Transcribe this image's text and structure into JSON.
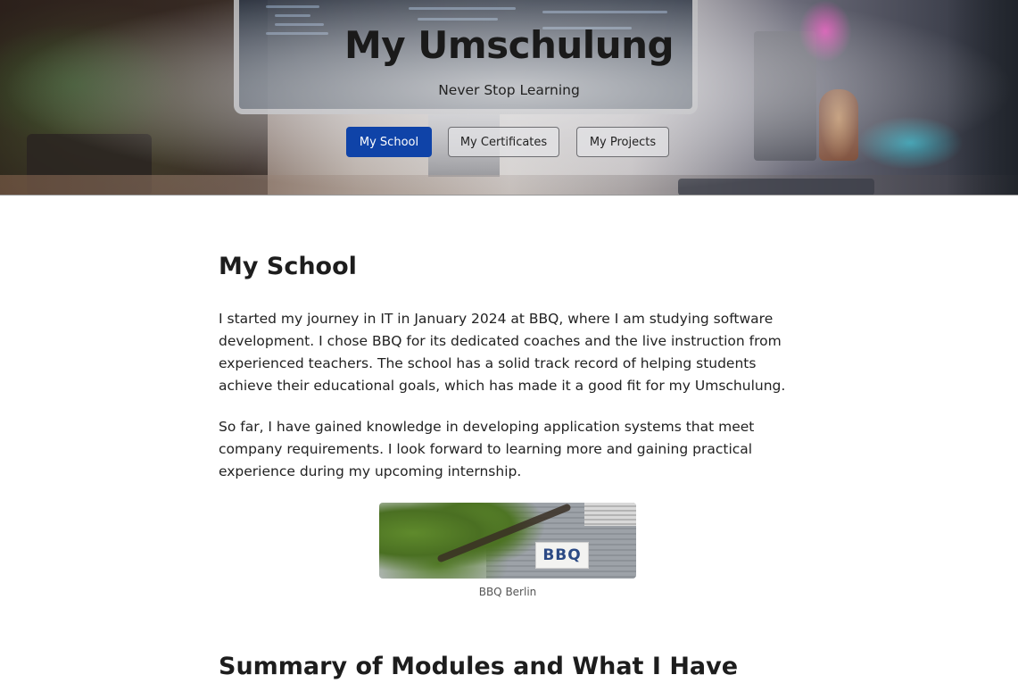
{
  "hero": {
    "title": "My Umschulung",
    "subtitle": "Never Stop Learning",
    "nav": [
      {
        "label": "My School",
        "active": true
      },
      {
        "label": "My Certificates",
        "active": false
      },
      {
        "label": "My Projects",
        "active": false
      }
    ]
  },
  "school": {
    "heading": "My School",
    "paragraphs": [
      "I started my journey in IT in January 2024 at BBQ, where I am studying software development. I chose BBQ for its dedicated coaches and the live instruction from experienced teachers. The school has a solid track record of helping students achieve their educational goals, which has made it a good fit for my Umschulung.",
      "So far, I have gained knowledge in developing application systems that meet company requirements. I look forward to learning more and gaining practical experience during my upcoming internship."
    ],
    "image_sign": "BBQ",
    "image_caption": "BBQ Berlin"
  },
  "modules": {
    "heading": "Summary of Modules and What I Have Learned"
  },
  "colors": {
    "nav_active_bg": "#0f43a8",
    "nav_inactive_bg": "#e1e1e4"
  }
}
